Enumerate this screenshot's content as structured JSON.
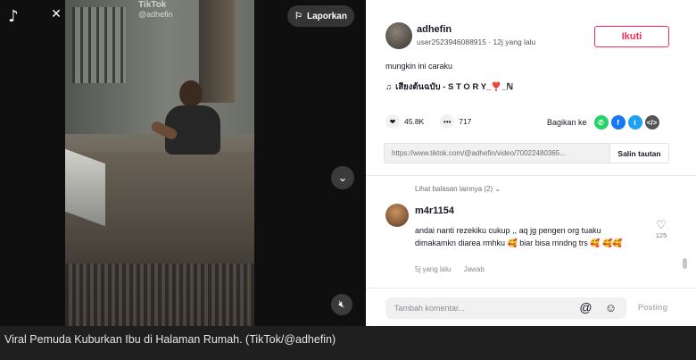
{
  "video": {
    "watermark_brand": "TikTok",
    "watermark_user": "@adhefin",
    "report_label": "Laporkan"
  },
  "author": {
    "username": "adhefin",
    "subline": "user2523946088915 · 12j yang lalu",
    "follow_label": "Ikuti"
  },
  "post": {
    "description": "mungkin ini caraku",
    "music": "เสียงต้นฉบับ - S T O R Y_❣️_ℕ"
  },
  "stats": {
    "likes": "45.8K",
    "comments": "717",
    "share_label": "Bagikan ke"
  },
  "link": {
    "url": "https://www.tiktok.com/@adhefin/video/70022480365...",
    "copy_label": "Salin tautan"
  },
  "comments": {
    "more_replies": "Lihat balasan lainnya (2)",
    "items": [
      {
        "user": "m4r1154",
        "text": "andai nanti rezekiku cukup ,, aq jg pengen org tuaku dimakamkn diarea rmhku 🥰 biar bisa mndng trs 🥰 🥰🥰",
        "time": "5j yang lalu",
        "reply_label": "Jawab",
        "likes": "125"
      }
    ]
  },
  "composer": {
    "placeholder": "Tambah komentar...",
    "post_label": "Posting"
  },
  "caption": "Viral Pemuda Kuburkan Ibu di Halaman Rumah. (TikTok/@adhefin)",
  "colors": {
    "follow_red": "#fe2c55",
    "whatsapp": "#25d366",
    "facebook": "#1877f2",
    "twitter": "#1da1f2",
    "embed": "#555555"
  },
  "icons": [
    "tiktok-logo-icon",
    "close-icon",
    "flag-icon",
    "chevron-down-icon",
    "mute-icon",
    "heart-icon",
    "comment-icon",
    "whatsapp-icon",
    "facebook-icon",
    "twitter-icon",
    "embed-icon",
    "at-icon",
    "emoji-icon"
  ]
}
